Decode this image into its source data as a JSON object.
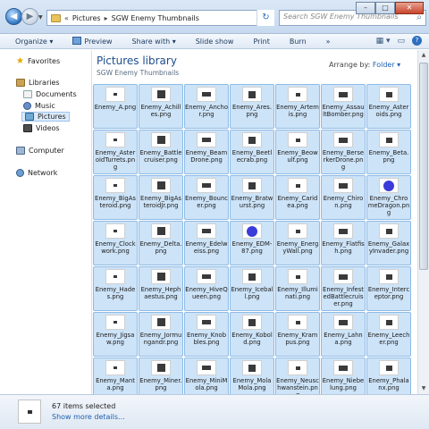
{
  "address": {
    "segments": [
      "Pictures",
      "SGW Enemy Thumbnails"
    ],
    "prefix": "«",
    "separator": "▸",
    "search_placeholder": "Search SGW Enemy Thumbnails"
  },
  "window_controls": {
    "minimize": "–",
    "maximize": "□",
    "close": "✕"
  },
  "toolbar": {
    "organize": "Organize ▾",
    "preview": "Preview",
    "share": "Share with ▾",
    "slideshow": "Slide show",
    "print": "Print",
    "burn": "Burn",
    "overflow": "»",
    "views_icon": "▦ ▾",
    "pane_icon": "▭",
    "help_icon": "?"
  },
  "nav": {
    "favorites": "Favorites",
    "libraries": "Libraries",
    "documents": "Documents",
    "music": "Music",
    "pictures": "Pictures",
    "videos": "Videos",
    "computer": "Computer",
    "network": "Network"
  },
  "main": {
    "title": "Pictures library",
    "subtitle": "SGW Enemy Thumbnails",
    "arrange_label": "Arrange by:",
    "arrange_value": "Folder ▾"
  },
  "files": [
    "Enemy_A.png",
    "Enemy_Achilles.png",
    "Enemy_Anchor.png",
    "Enemy_Ares.png",
    "Enemy_Artemis.png",
    "Enemy_AssaultBomber.png",
    "Enemy_Asteroids.png",
    "Enemy_AsteroidTurrets.png",
    "Enemy_Battlecruiser.png",
    "Enemy_BeamDrone.png",
    "Enemy_Beetlecrab.png",
    "Enemy_Beowulf.png",
    "Enemy_BerserkerDrone.png",
    "Enemy_Beta.png",
    "Enemy_BigAsteroid.png",
    "Enemy_BigAsteroidJr.png",
    "Enemy_Bouncer.png",
    "Enemy_Bratwurst.png",
    "Enemy_Caridea.png",
    "Enemy_Chiron.png",
    "Enemy_ChromeDragon.png",
    "Enemy_Clockwork.png",
    "Enemy_Delta.png",
    "Enemy_Edelweiss.png",
    "Enemy_EDM-87.png",
    "Enemy_EnergyWall.png",
    "Enemy_Flatfish.png",
    "Enemy_GalaxyInvader.png",
    "Enemy_Hades.png",
    "Enemy_Hephaestus.png",
    "Enemy_HiveQueen.png",
    "Enemy_Iceball.png",
    "Enemy_Illuminati.png",
    "Enemy_InfestedBattlecruiser.png",
    "Enemy_Interceptor.png",
    "Enemy_Jigsaw.png",
    "Enemy_Jormungandr.png",
    "Enemy_Knobbles.png",
    "Enemy_Kobold.png",
    "Enemy_Krampus.png",
    "Enemy_Lahna.png",
    "Enemy_Leecher.png",
    "Enemy_Manta.png",
    "Enemy_Miner.png",
    "Enemy_MiniMola.png",
    "Enemy_MolaMola.png",
    "Enemy_Neuschwanstein.png",
    "Enemy_Niebelung.png",
    "Enemy_Phalanx.png"
  ],
  "file_labels": [
    "Enemy_A.png",
    "Enemy_Achilles.png",
    "Enemy_Anchor.png",
    "Enemy_Ares.png",
    "Enemy_Artemis.png",
    "Enemy_AssaultBomber.png",
    "Enemy_Asteroids.png",
    "Enemy_AsteroidTurrets.png",
    "Enemy_Battlecruiser.png",
    "Enemy_BeamDrone.png",
    "Enemy_Beetlecrab.png",
    "Enemy_Beowulf.png",
    "Enemy_BerserkerDrone.png",
    "Enemy_Beta.png",
    "Enemy_BigAsteroid.png",
    "Enemy_BigAsteroidJr.png",
    "Enemy_Bouncer.png",
    "Enemy_Bratwurst.png",
    "Enemy_Caridea.png",
    "Enemy_Chiron.png",
    "Enemy_ChromeDragon.png",
    "Enemy_Clockwork.png",
    "Enemy_Delta.png",
    "Enemy_Edelweiss.png",
    "Enemy_EDM-87.png",
    "Enemy_EnergyWall.png",
    "Enemy_Flatfish.png",
    "Enemy_GalaxyInvader.png",
    "Enemy_Hades.png",
    "Enemy_Hephaestus.png",
    "Enemy_HiveQueen.png",
    "Enemy_Iceball.png",
    "Enemy_Illuminati.png",
    "Enemy_InfestedBattlecruiser.png",
    "Enemy_Interceptor.png",
    "Enemy_Jigsaw.png",
    "Enemy_Jormungandr.png",
    "Enemy_Knobbles.png",
    "Enemy_Kobold.png",
    "Enemy_Krampus.png",
    "Enemy_Lahna.png",
    "Enemy_Leecher.png",
    "Enemy_Manta.png",
    "Enemy_Miner.png",
    "Enemy_MiniMola.png",
    "Enemy_MolaMola.png",
    "Enemy_Neuschwanstein.png",
    "Enemy_Niebelung.png",
    "Enemy_Phalanx.png"
  ],
  "status": {
    "selected": "67 items selected",
    "more": "Show more details..."
  }
}
